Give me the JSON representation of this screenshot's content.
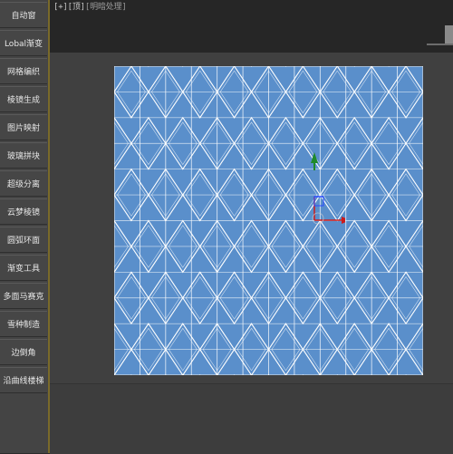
{
  "sidebar": {
    "items": [
      {
        "label": "自动窗"
      },
      {
        "label": "Lobal渐变"
      },
      {
        "label": "网格编织"
      },
      {
        "label": "棱镜生成"
      },
      {
        "label": "图片映射"
      },
      {
        "label": "玻璃拼块"
      },
      {
        "label": "超级分离"
      },
      {
        "label": "云梦棱镜"
      },
      {
        "label": "圆弧环面"
      },
      {
        "label": "渐变工具"
      },
      {
        "label": "多面马赛克"
      },
      {
        "label": "雪种制造"
      },
      {
        "label": "边倒角"
      },
      {
        "label": "沿曲线楼梯"
      }
    ]
  },
  "viewport": {
    "label_bracket": "[+]",
    "label_view": "[顶]",
    "label_shading": "[明暗处理]",
    "gizmo_x_label": "X",
    "colors": {
      "panel_background": "#444444",
      "viewport_background": "#404040",
      "pattern_fill": "#5a8fcb",
      "pattern_lines": "#ffffff",
      "axis_x": "#cc1a1a",
      "axis_y": "#1f8a2a",
      "axis_z": "#2a4aff",
      "sidebar_accent": "#7a6a2a"
    }
  }
}
